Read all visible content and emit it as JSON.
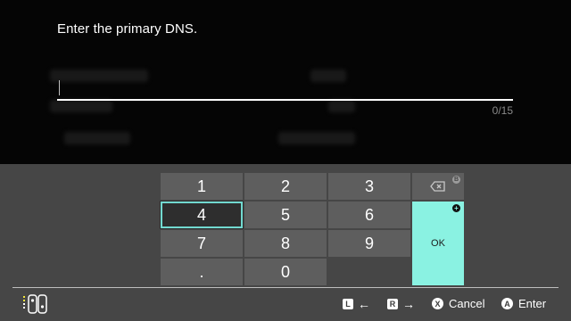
{
  "dialog": {
    "prompt": "Enter the primary DNS.",
    "input_value": "",
    "char_counter": "0/15"
  },
  "keyboard": {
    "keys": [
      "1",
      "2",
      "3",
      "4",
      "5",
      "6",
      "7",
      "8",
      "9",
      ".",
      "0"
    ],
    "selected_key": "4",
    "ok_label": "OK",
    "accent_color": "#8af2e2"
  },
  "footer": {
    "hints": [
      {
        "button": "L",
        "action_icon": "left-arrow-icon"
      },
      {
        "button": "R",
        "action_icon": "right-arrow-icon"
      },
      {
        "button": "X",
        "label": "Cancel"
      },
      {
        "button": "A",
        "label": "Enter"
      }
    ]
  }
}
